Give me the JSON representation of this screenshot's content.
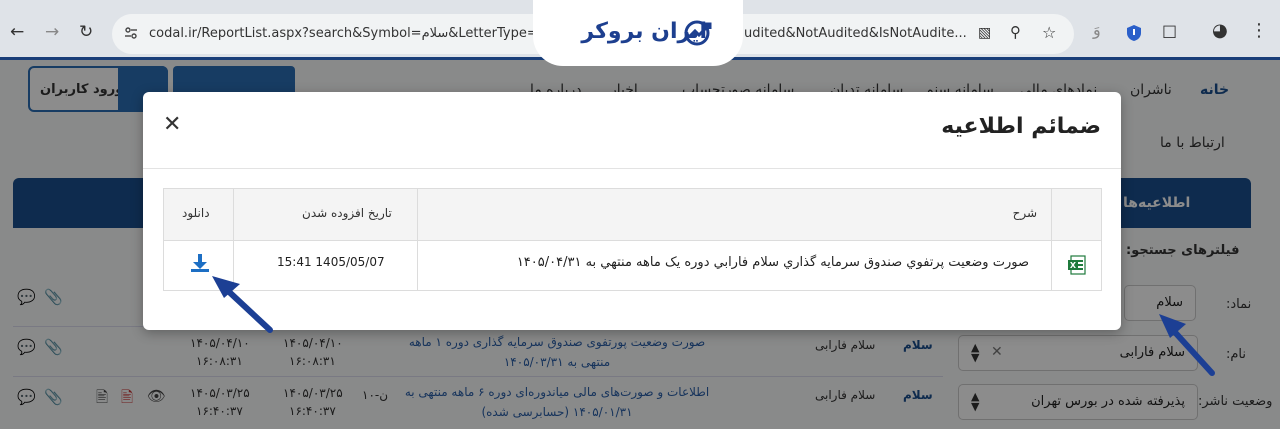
{
  "browser": {
    "url_left": "codal.ir/ReportList.aspx?search&Symbol=سلام&LetterType=-1&",
    "url_right": "udited&NotAudited&IsNotAudite...",
    "lang_badge": "وَ"
  },
  "watermark": {
    "text": "ایران بروکر"
  },
  "site": {
    "login_label": "ورود کاربران",
    "nav": [
      "خانه",
      "ناشران",
      "نمادهای مالی",
      "سامانه سنم",
      "سامانه تدبان",
      "سامانه صورتحساب",
      "اخبار",
      "درباره ما"
    ],
    "contact": "ارتباط با ما",
    "announcements_tab": "اطلاعیه‌ها",
    "filter_title": "فیلترهای جستجو:",
    "filters": {
      "symbol_label": "نماد:",
      "symbol_value": "سلام",
      "name_label": "نام:",
      "name_value": "سلام فارابی",
      "status_label": "وضعیت ناشر:",
      "status_value": "پذیرفته شده در بورس تهران"
    },
    "rows": [
      {
        "symbol": "سلام",
        "name": "سلام فارابی",
        "code": "",
        "title": "صورت وضعیت پورتفوی صندوق سرمایه گذاری دوره ۱ ماهه منتهی به ۱۴۰۵/۰۳/۳۱",
        "sent_date": "۱۴۰۵/۰۴/۱۰",
        "sent_time": "۱۶:۰۸:۳۱",
        "pub_date": "۱۴۰۵/۰۴/۱۰",
        "pub_time": "۱۶:۰۸:۳۱"
      },
      {
        "symbol": "سلام",
        "name": "سلام فارابی",
        "code": "ن-۱۰",
        "title": "اطلاعات و صورت‌های مالی میاندوره‌ای دوره ۶ ماهه منتهی به ۱۴۰۵/۰۱/۳۱ (حسابرسی شده)",
        "sent_date": "۱۴۰۵/۰۳/۲۵",
        "sent_time": "۱۶:۴۰:۳۷",
        "pub_date": "۱۴۰۵/۰۳/۲۵",
        "pub_time": "۱۶:۴۰:۳۷"
      }
    ]
  },
  "modal": {
    "title": "ضمائم اطلاعیه",
    "columns": {
      "description": "شرح",
      "date_added": "تاریخ افزوده شدن",
      "download": "دانلود"
    },
    "attachment": {
      "description": "صورت وضعيت پرتفوي صندوق سرمايه گذاري سلام فارابي دوره يک ماهه منتهي به ۱۴۰۵/۰۴/۳۱",
      "date_added": "1405/05/07 15:41",
      "file_icon": "excel-file-icon",
      "download_icon": "download-icon"
    }
  },
  "colors": {
    "brand_blue": "#1a4f8e",
    "download_blue": "#1d6fc4",
    "arrow_blue": "#1c3f94",
    "excel_green": "#1f7a3c"
  }
}
